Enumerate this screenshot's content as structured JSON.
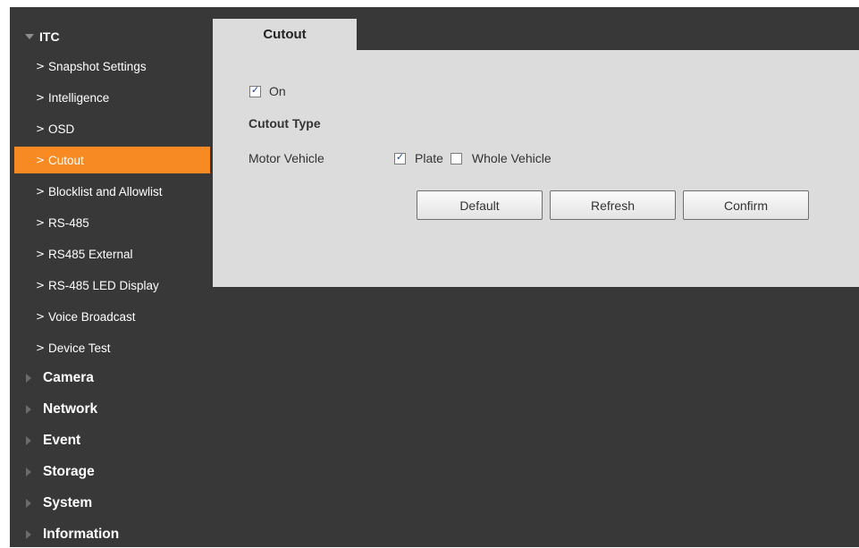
{
  "sidebar": {
    "header": "ITC",
    "sub_items": [
      {
        "label": "Snapshot Settings",
        "active": false
      },
      {
        "label": "Intelligence",
        "active": false
      },
      {
        "label": "OSD",
        "active": false
      },
      {
        "label": "Cutout",
        "active": true
      },
      {
        "label": "Blocklist and Allowlist",
        "active": false
      },
      {
        "label": "RS-485",
        "active": false
      },
      {
        "label": "RS485 External",
        "active": false
      },
      {
        "label": "RS-485 LED Display",
        "active": false
      },
      {
        "label": "Voice Broadcast",
        "active": false
      },
      {
        "label": "Device Test",
        "active": false
      }
    ],
    "main_items": [
      "Camera",
      "Network",
      "Event",
      "Storage",
      "System",
      "Information"
    ]
  },
  "tab": {
    "label": "Cutout"
  },
  "form": {
    "on": {
      "label": "On",
      "checked": true
    },
    "cutout_type_label": "Cutout Type",
    "motor_vehicle_label": "Motor Vehicle",
    "plate": {
      "label": "Plate",
      "checked": true
    },
    "whole_vehicle": {
      "label": "Whole Vehicle",
      "checked": false
    }
  },
  "buttons": {
    "default": "Default",
    "refresh": "Refresh",
    "confirm": "Confirm"
  },
  "colors": {
    "accent": "#f78a22",
    "background": "#383838",
    "panel": "#dcdcdc"
  }
}
